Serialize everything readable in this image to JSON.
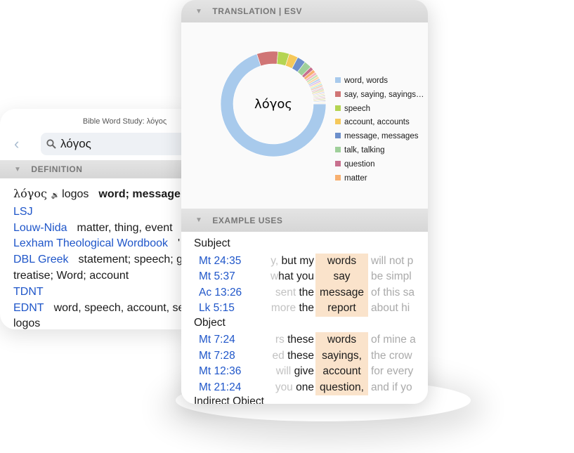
{
  "window_title": "Bible Word Study: λόγος",
  "search": {
    "value": "λόγος",
    "icon": "search-icon"
  },
  "definition": {
    "header": "DEFINITION",
    "headword": "λόγος",
    "transliteration": "logos",
    "gloss": "word; message",
    "entries": [
      {
        "source": "LSJ",
        "text": ""
      },
      {
        "source": "Louw-Nida",
        "text": "matter, thing, event"
      },
      {
        "source": "Lexham Theological Wordbook",
        "text": "'"
      },
      {
        "source": "DBL Greek",
        "text": "statement; speech; g"
      },
      {
        "source": "",
        "text": "treatise; Word; account"
      },
      {
        "source": "TDNT",
        "text": ""
      },
      {
        "source": "EDNT",
        "text": "word, speech, account, se"
      },
      {
        "source": "",
        "text": "logos"
      }
    ]
  },
  "translation": {
    "header": "TRANSLATION | ESV",
    "center_label": "λόγος"
  },
  "chart_data": {
    "type": "pie",
    "donut": true,
    "categories": [
      "word, words",
      "say, saying, sayings…",
      "speech",
      "account, accounts",
      "message, messages",
      "talk, talking",
      "question",
      "matter"
    ],
    "values": [
      70,
      6.5,
      3.5,
      2.8,
      2.6,
      2.3,
      1.1,
      1
    ],
    "colors": [
      "#a8caec",
      "#d07575",
      "#b4d452",
      "#f5c85a",
      "#6d8fcb",
      "#9fcf9a",
      "#c8708e",
      "#f8b070"
    ],
    "other_values": [
      0.8,
      0.7,
      0.7,
      0.6,
      0.6,
      0.5,
      0.5,
      0.5,
      0.4,
      0.4,
      0.4,
      0.4,
      0.3,
      0.3,
      0.3,
      0.3,
      0.3,
      0.3,
      0.3,
      0.3,
      0.3,
      0.3,
      0.2,
      0.2,
      0.2,
      0.2
    ],
    "legend": "right"
  },
  "examples": {
    "header": "EXAMPLE USES",
    "groups": [
      {
        "label": "Subject",
        "rows": [
          {
            "ref": "Mt 24:35",
            "left_faded": "y, ",
            "left": "but my",
            "keyword": "words",
            "right": "will not p"
          },
          {
            "ref": "Mt 5:37",
            "left_faded": "w",
            "left": "hat you",
            "keyword": "say",
            "right": "be simpl"
          },
          {
            "ref": "Ac 13:26",
            "left_faded": "sent ",
            "left": "the",
            "keyword": "message",
            "right": "of this sa"
          },
          {
            "ref": "Lk 5:15",
            "left_faded": "more ",
            "left": "the",
            "keyword": "report",
            "right": "about hi"
          }
        ]
      },
      {
        "label": "Object",
        "rows": [
          {
            "ref": "Mt 7:24",
            "left_faded": "rs ",
            "left": "these",
            "keyword": "words",
            "right": "of mine a"
          },
          {
            "ref": "Mt 7:28",
            "left_faded": "ed ",
            "left": "these",
            "keyword": "sayings,",
            "right": "the crow"
          },
          {
            "ref": "Mt 12:36",
            "left_faded": "will ",
            "left": "give",
            "keyword": "account",
            "right": "for every"
          },
          {
            "ref": "Mt 21:24",
            "left_faded": "you ",
            "left": "one",
            "keyword": "question,",
            "right": "and if yo"
          }
        ]
      },
      {
        "label": "Indirect Object",
        "rows": []
      }
    ]
  }
}
